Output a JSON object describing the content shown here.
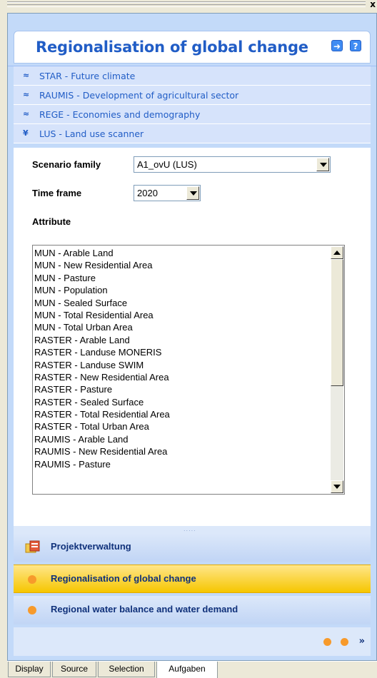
{
  "window": {
    "close_glyph": "x"
  },
  "panel": {
    "title": "Regionalisation of global change",
    "header_icons": [
      "next-arrow-icon",
      "help-icon"
    ]
  },
  "sections": [
    {
      "label": "STAR - Future climate",
      "state": "collapsed"
    },
    {
      "label": "RAUMIS - Development of agricultural sector",
      "state": "collapsed"
    },
    {
      "label": "REGE - Economies and demography",
      "state": "collapsed"
    },
    {
      "label": "LUS - Land use scanner",
      "state": "expanded"
    }
  ],
  "form": {
    "scenario_label": "Scenario family",
    "scenario_value": "A1_ovU (LUS)",
    "timeframe_label": "Time frame",
    "timeframe_value": "2020",
    "attribute_label": "Attribute"
  },
  "attributes": [
    "MUN - Arable Land",
    "MUN - New Residential Area",
    "MUN - Pasture",
    "MUN - Population",
    "MUN - Sealed Surface",
    "MUN - Total Residential Area",
    "MUN - Total Urban Area",
    "RASTER - Arable Land",
    "RASTER - Landuse MONERIS",
    "RASTER - Landuse SWIM",
    "RASTER - New Residential Area",
    "RASTER - Pasture",
    "RASTER - Sealed Surface",
    "RASTER - Total Residential Area",
    "RASTER - Total Urban Area",
    "RAUMIS - Arable Land",
    "RAUMIS - New Residential Area",
    "RAUMIS - Pasture"
  ],
  "splitter": {
    "grip": "....."
  },
  "nav": {
    "projekt": "Projektverwaltung",
    "regional_global": "Regionalisation of global change",
    "water_balance": "Regional water balance and water demand",
    "more": "»"
  },
  "tabs": [
    "Display",
    "Source",
    "Selection",
    "Aufgaben"
  ],
  "colors": {
    "accent": "#215DC6",
    "selected_nav": "#F6C600",
    "orange_dot": "#F79A2B"
  }
}
